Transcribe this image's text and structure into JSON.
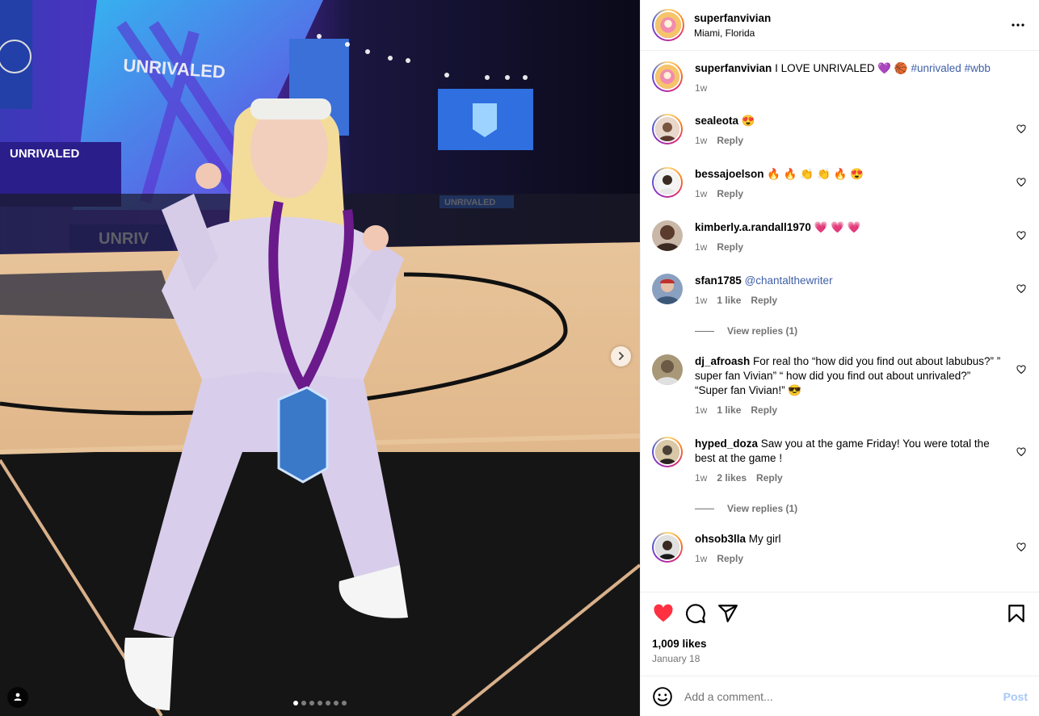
{
  "header": {
    "username": "superfanvivian",
    "location": "Miami, Florida",
    "more_icon": "more-horizontal-icon"
  },
  "caption": {
    "username": "superfanvivian",
    "text": "I LOVE UNRIVALED 💜 🏀",
    "hashtags": [
      "#unrivaled",
      "#wbb"
    ],
    "time": "1w"
  },
  "comments": [
    {
      "username": "sealeota",
      "text": "😍",
      "mention": "",
      "time": "1w",
      "likes": "",
      "reply": "Reply",
      "avatar_color": "#7a5540"
    },
    {
      "username": "bessajoelson",
      "text": "🔥 🔥 👏 👏 🔥 😍",
      "mention": "",
      "time": "1w",
      "likes": "",
      "reply": "Reply",
      "avatar_color": "#2d2d2d"
    },
    {
      "username": "kimberly.a.randall1970",
      "text": "💗 💗 💗",
      "mention": "",
      "time": "1w",
      "likes": "",
      "reply": "Reply",
      "avatar_color": "#5a3b2c"
    },
    {
      "username": "sfan1785",
      "text": "",
      "mention": "@chantalthewriter",
      "time": "1w",
      "likes": "1 like",
      "reply": "Reply",
      "avatar_color": "#3c5878"
    },
    {
      "username": "dj_afroash",
      "text": "For real tho “how did you find out about labubus?” ” super fan Vivian” “ how did you find out about unrivaled?” “Super fan Vivian!” 😎",
      "mention": "",
      "time": "1w",
      "likes": "1 like",
      "reply": "Reply",
      "avatar_color": "#6b5a45"
    },
    {
      "username": "hyped_doza",
      "text": "Saw you at the game Friday! You were total the best at the game !",
      "mention": "",
      "time": "1w",
      "likes": "2 likes",
      "reply": "Reply",
      "avatar_color": "#4a4035"
    },
    {
      "username": "ohsob3lla",
      "text": "My girl",
      "mention": "",
      "time": "1w",
      "likes": "",
      "reply": "Reply",
      "avatar_color": "#3a2a22"
    }
  ],
  "view_replies": [
    "View replies (1)",
    "View replies (1)"
  ],
  "actions": {
    "like_icon": "heart-filled-icon",
    "comment_icon": "comment-icon",
    "share_icon": "share-icon",
    "save_icon": "bookmark-icon",
    "likes": "1,009 likes",
    "date": "January 18"
  },
  "add_comment": {
    "placeholder": "Add a comment...",
    "post_label": "Post",
    "emoji_icon": "emoji-icon"
  },
  "carousel": {
    "slide_count": 7,
    "active_index": 0
  },
  "colors": {
    "like_red": "#ff3040",
    "link_blue": "#4060a8",
    "muted": "#737373",
    "post_blue": "#a8c8f8"
  }
}
